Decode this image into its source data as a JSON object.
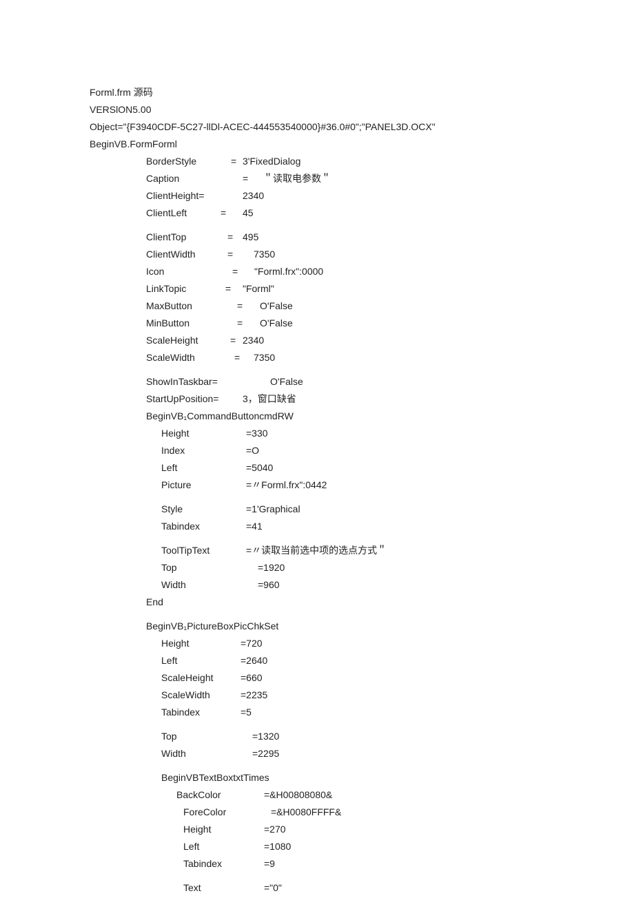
{
  "header": {
    "line1": "Forml.frm 源码",
    "line2": "VERSlON5.00",
    "line3": "Object=\"{F3940CDF-5C27-llDl-ACEC-444553540000}#36.0#0\";\"PANEL3D.OCX\"",
    "line4": "BeginVB.FormForml"
  },
  "form": {
    "borderstyle": {
      "label": "BorderStyle",
      "eq": "=",
      "val": "3'FixedDialog"
    },
    "caption": {
      "label": "Caption",
      "eq": "=",
      "val": "＂读取电参数＂"
    },
    "clientheight": {
      "label": "ClientHeight=",
      "eq": "",
      "val": "2340"
    },
    "clientleft": {
      "label": "ClientLeft",
      "eq": "=",
      "val": "45"
    },
    "clienttop": {
      "label": "ClientTop",
      "eq": "=",
      "val": "495"
    },
    "clientwidth": {
      "label": "ClientWidth",
      "eq": "=",
      "val": "7350"
    },
    "icon": {
      "label": "Icon",
      "eq": "=",
      "val": "\"Forml.frx\":0000"
    },
    "linktopic": {
      "label": "LinkTopic",
      "eq": "=",
      "val": "\"Forml\""
    },
    "maxbutton": {
      "label": "MaxButton",
      "eq": "=",
      "val": "O'False"
    },
    "minbutton": {
      "label": "MinButton",
      "eq": "=",
      "val": "O'False"
    },
    "scaleheight": {
      "label": "ScaleHeight",
      "eq": "=",
      "val": "2340"
    },
    "scalewidth": {
      "label": "ScaleWidth",
      "eq": "=",
      "val": "7350"
    },
    "showintaskbar": {
      "label": "ShowInTaskbar=",
      "eq": "",
      "val": "O'False"
    },
    "startupposition": {
      "label": "StartUpPosition=",
      "eq": "",
      "val": "3，窗口缺省"
    },
    "begin_cmdrw": "BeginVB₁CommandButtoncmdRW"
  },
  "cmdrw": {
    "height": {
      "label": "Height",
      "val": "=330"
    },
    "index": {
      "label": "Index",
      "val": "=O"
    },
    "left": {
      "label": "Left",
      "val": "=5040"
    },
    "picture": {
      "label": "Picture",
      "val": "=〃Forml.frx\":0442"
    },
    "style": {
      "label": "Style",
      "val": "=1'Graphical"
    },
    "tabindex": {
      "label": "Tabindex",
      "val": "=41"
    },
    "tooltiptext": {
      "label": "ToolTipText",
      "val": "=〃读取当前选中项的选点方式＂"
    },
    "top": {
      "label": "Top",
      "val": "=1920"
    },
    "width": {
      "label": "Width",
      "val": "=960"
    }
  },
  "end1": "End",
  "picchkset": {
    "begin": "BeginVB₁PictureBoxPicChkSet",
    "height": {
      "label": "Height",
      "val": "=720"
    },
    "left": {
      "label": "Left",
      "val": "=2640"
    },
    "scaleheight": {
      "label": "ScaleHeight",
      "val": "=660"
    },
    "scalewidth": {
      "label": "ScaleWidth",
      "val": "=2235"
    },
    "tabindex": {
      "label": "Tabindex",
      "val": "=5"
    },
    "top": {
      "label": "Top",
      "val": "=1320"
    },
    "width": {
      "label": "Width",
      "val": "=2295"
    },
    "begin_txt": "BeginVBTextBoxtxtTimes"
  },
  "txttimes": {
    "backcolor": {
      "label": "BackColor",
      "val": "=&H00808080&"
    },
    "forecolor": {
      "label": "ForeColor",
      "val": "=&H0080FFFF&"
    },
    "height": {
      "label": "Height",
      "val": "=270"
    },
    "left": {
      "label": "Left",
      "val": "=1080"
    },
    "tabindex": {
      "label": "Tabindex",
      "val": "=9"
    },
    "text": {
      "label": "Text",
      "val": "=\"0\""
    }
  }
}
